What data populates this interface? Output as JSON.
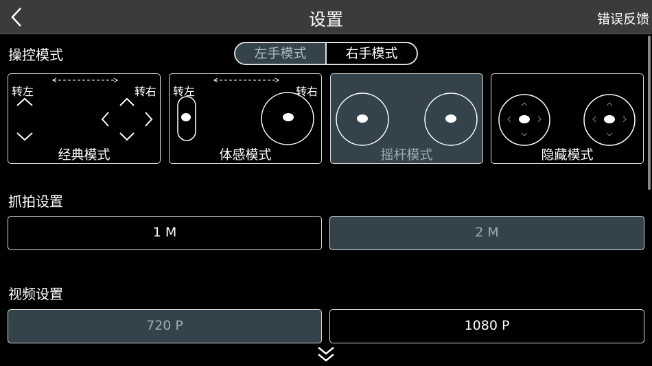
{
  "header": {
    "title": "设置",
    "feedback": "错误反馈",
    "back_icon": "chevron-left-icon"
  },
  "control": {
    "label": "操控模式",
    "hand_modes": [
      {
        "label": "左手模式",
        "active": true
      },
      {
        "label": "右手模式",
        "active": false
      }
    ],
    "turn_left": "转左",
    "turn_right": "转右",
    "modes": [
      {
        "label": "经典模式",
        "selected": false
      },
      {
        "label": "体感模式",
        "selected": false
      },
      {
        "label": "摇杆模式",
        "selected": true
      },
      {
        "label": "隐藏模式",
        "selected": false
      }
    ]
  },
  "snapshot": {
    "label": "抓拍设置",
    "options": [
      {
        "label": "1 M",
        "selected": false
      },
      {
        "label": "2 M",
        "selected": true
      }
    ]
  },
  "video": {
    "label": "视频设置",
    "options": [
      {
        "label": "720 P",
        "selected": true
      },
      {
        "label": "1080 P",
        "selected": false
      }
    ]
  },
  "colors": {
    "header_bg": "#3b3b3b",
    "selected_bg": "#34434b",
    "selected_text": "#9eacb3"
  },
  "more_icon": "double-chevron-down-icon"
}
